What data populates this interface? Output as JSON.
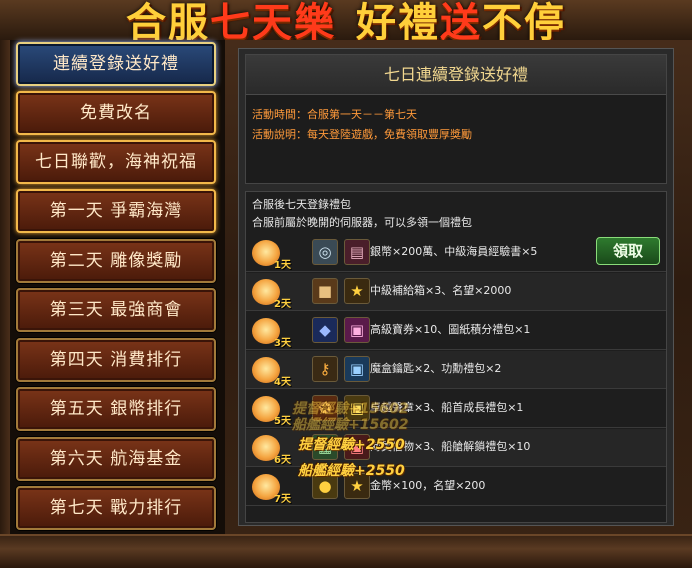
{
  "banner": {
    "part1": "合服",
    "part2": "七天樂",
    "part3": "好禮",
    "part4": "送",
    "part5": "不停"
  },
  "menu": {
    "items": [
      {
        "label": "連續登錄送好禮",
        "state": "active"
      },
      {
        "label": "免費改名",
        "state": "glow"
      },
      {
        "label": "七日聯歡，海神祝福",
        "state": "glow"
      },
      {
        "label": "第一天  爭霸海灣",
        "state": "glow"
      },
      {
        "label": "第二天  雕像獎勵",
        "state": "dim"
      },
      {
        "label": "第三天  最強商會",
        "state": "dim"
      },
      {
        "label": "第四天  消費排行",
        "state": "dim"
      },
      {
        "label": "第五天  銀幣排行",
        "state": "dim"
      },
      {
        "label": "第六天  航海基金",
        "state": "dim"
      },
      {
        "label": "第七天  戰力排行",
        "state": "dim"
      }
    ]
  },
  "panel": {
    "title": "七日連續登錄送好禮",
    "time": "活動時間：合服第一天－－第七天",
    "desc": "活動說明：每天登陸遊戲，免費領取豐厚獎勵",
    "list_note1": "合服後七天登錄禮包",
    "list_note2": "合服前屬於晚開的伺服器，可以多領一個禮包",
    "claim_label": "領取",
    "rows": [
      {
        "day": "1天",
        "icon1": "coin-stack-icon",
        "icon2": "scroll-book-icon",
        "reward": "銀幣×200萬、中級海員經驗書×5"
      },
      {
        "day": "2天",
        "icon1": "supply-crate-icon",
        "icon2": "star-badge-icon",
        "reward": "中級補給箱×3、名望×2000"
      },
      {
        "day": "3天",
        "icon1": "gem-cluster-icon",
        "icon2": "gift-box-icon",
        "reward": "高級寶券×10、圖紙積分禮包×1"
      },
      {
        "day": "4天",
        "icon1": "key-icon",
        "icon2": "gift-box-icon",
        "reward": "魔盒鑰匙×2、功勳禮包×2"
      },
      {
        "day": "5天",
        "icon1": "medal-icon",
        "icon2": "gift-box-icon",
        "reward": "卓越聲章×3、船首成長禮包×1"
      },
      {
        "day": "6天",
        "icon1": "chest-icon",
        "icon2": "gift-box-icon",
        "reward": "海員信物×3、船艙解鎖禮包×10"
      },
      {
        "day": "7天",
        "icon1": "gold-coin-icon",
        "icon2": "star-badge-icon",
        "reward": "金幣×100，名望×200"
      }
    ]
  },
  "overlay": {
    "exp1": "提督經驗+15602",
    "exp2": "船艦經驗+15602",
    "exp3": "提督經驗+2550",
    "exp4": "船艦經驗+2550"
  },
  "colors": {
    "accent_gold": "#ffcf3a",
    "banner_red": "#ff3a1a",
    "info_orange": "#ff9a3a",
    "claim_green": "#2e7a2e"
  }
}
